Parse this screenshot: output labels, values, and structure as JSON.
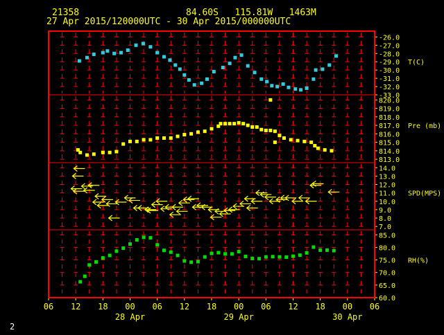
{
  "header": {
    "station": "21358",
    "location": "84.60S   115.81W   1463M",
    "period": "27 Apr 2015/120000UTC - 30 Apr 2015/000000UTC"
  },
  "footer": {
    "page_number": "2"
  },
  "colors": {
    "frame": "#ff0000",
    "grid_cross": "#ff0000",
    "header_text": "#ffff00",
    "axis_text": "#ffff00",
    "temperature": "#33ccdd",
    "pressure": "#ffff00",
    "wind": "#ffff00",
    "humidity": "#00dd00",
    "footer_text": "#ffffff"
  },
  "chart_data": {
    "type": "scatter",
    "x_axis": {
      "unit": "hours since 27 Apr 2015 06 UTC",
      "range": [
        0,
        72
      ],
      "tick_labels": [
        "06",
        "12",
        "18",
        "00",
        "06",
        "12",
        "18",
        "00",
        "06",
        "12",
        "18",
        "00",
        "06"
      ],
      "date_labels": [
        {
          "text": "28 Apr",
          "x": 18
        },
        {
          "text": "29 Apr",
          "x": 42
        },
        {
          "text": "30 Apr",
          "x": 66
        }
      ],
      "grid_lines_every_hours": 3
    },
    "panels": [
      {
        "name": "temperature",
        "label": "T(C)",
        "ylim": [
          -33.0,
          -25.3
        ],
        "tick_labels": [
          "-26.0",
          "-27.0",
          "-28.0",
          "-29.0",
          "-30.0",
          "-31.0",
          "-32.0",
          "-33.0"
        ],
        "tick_values": [
          -26,
          -27,
          -28,
          -29,
          -30,
          -31,
          -32,
          -33
        ],
        "label_at": -29.0,
        "points": [
          [
            6.8,
            -28.9
          ],
          [
            8.5,
            -28.5
          ],
          [
            10.0,
            -28.1
          ],
          [
            12.0,
            -27.9
          ],
          [
            13.0,
            -27.7
          ],
          [
            14.5,
            -28.0
          ],
          [
            16.0,
            -27.9
          ],
          [
            17.5,
            -27.6
          ],
          [
            19.3,
            -27.0
          ],
          [
            20.9,
            -26.8
          ],
          [
            22.5,
            -27.2
          ],
          [
            24.0,
            -27.9
          ],
          [
            25.5,
            -28.4
          ],
          [
            26.8,
            -28.8
          ],
          [
            28.0,
            -29.4
          ],
          [
            29.0,
            -29.9
          ],
          [
            30.0,
            -30.6
          ],
          [
            31.0,
            -31.2
          ],
          [
            32.2,
            -31.8
          ],
          [
            33.8,
            -31.6
          ],
          [
            35.0,
            -31.1
          ],
          [
            36.5,
            -30.2
          ],
          [
            38.5,
            -29.7
          ],
          [
            40.0,
            -29.2
          ],
          [
            41.2,
            -28.5
          ],
          [
            42.6,
            -28.2
          ],
          [
            44.0,
            -29.5
          ],
          [
            45.5,
            -30.3
          ],
          [
            47.0,
            -31.1
          ],
          [
            48.2,
            -31.4
          ],
          [
            49.3,
            -31.9
          ],
          [
            50.5,
            -32.0
          ],
          [
            51.8,
            -31.7
          ],
          [
            53.0,
            -32.1
          ],
          [
            54.5,
            -32.3
          ],
          [
            55.7,
            -32.4
          ],
          [
            57.0,
            -32.2
          ],
          [
            58.5,
            -31.1
          ],
          [
            59.0,
            -30.0
          ],
          [
            60.5,
            -29.9
          ],
          [
            62.0,
            -29.4
          ],
          [
            63.5,
            -28.3
          ]
        ]
      },
      {
        "name": "pressure",
        "label": "Pre (mb)",
        "ylim": [
          812.6,
          820.6
        ],
        "tick_labels": [
          "820.0",
          "819.0",
          "818.0",
          "817.0",
          "816.0",
          "815.0",
          "814.0",
          "813.0"
        ],
        "tick_values": [
          820,
          819,
          818,
          817,
          816,
          815,
          814,
          813
        ],
        "label_at": 817.0,
        "points": [
          [
            6.5,
            814.1
          ],
          [
            7.0,
            813.8
          ],
          [
            8.5,
            813.5
          ],
          [
            10.0,
            813.6
          ],
          [
            12.0,
            813.8
          ],
          [
            13.5,
            813.8
          ],
          [
            15.0,
            813.9
          ],
          [
            16.5,
            814.8
          ],
          [
            18.0,
            815.1
          ],
          [
            19.5,
            815.1
          ],
          [
            21.0,
            815.3
          ],
          [
            22.5,
            815.3
          ],
          [
            24.0,
            815.5
          ],
          [
            25.5,
            815.5
          ],
          [
            27.0,
            815.5
          ],
          [
            28.5,
            815.7
          ],
          [
            30.0,
            815.9
          ],
          [
            31.5,
            816.0
          ],
          [
            33.0,
            816.2
          ],
          [
            34.5,
            816.3
          ],
          [
            36.0,
            816.6
          ],
          [
            37.5,
            816.9
          ],
          [
            38.0,
            817.2
          ],
          [
            39.0,
            817.2
          ],
          [
            40.0,
            817.2
          ],
          [
            41.0,
            817.2
          ],
          [
            42.0,
            817.3
          ],
          [
            43.0,
            817.2
          ],
          [
            44.0,
            817.0
          ],
          [
            45.0,
            816.8
          ],
          [
            46.0,
            816.8
          ],
          [
            47.0,
            816.5
          ],
          [
            48.0,
            816.4
          ],
          [
            49.0,
            816.4
          ],
          [
            50.0,
            816.3
          ],
          [
            50.0,
            815.0
          ],
          [
            49.0,
            820.0
          ],
          [
            51.0,
            815.8
          ],
          [
            52.0,
            815.5
          ],
          [
            53.5,
            815.3
          ],
          [
            55.0,
            815.2
          ],
          [
            56.5,
            815.1
          ],
          [
            58.0,
            815.0
          ],
          [
            58.8,
            814.6
          ],
          [
            59.5,
            814.3
          ],
          [
            61.0,
            814.1
          ],
          [
            62.5,
            814.0
          ]
        ]
      },
      {
        "name": "wind",
        "label": "SPD(MPS)",
        "ylim": [
          6.6,
          14.6
        ],
        "tick_labels": [
          "14.0",
          "13.0",
          "12.0",
          "11.0",
          "10.0",
          "9.0",
          "8.0",
          "7.0"
        ],
        "tick_values": [
          14,
          13,
          12,
          11,
          10,
          9,
          8,
          7
        ],
        "label_at": 11.0,
        "arrows": [
          [
            6.8,
            13.9
          ],
          [
            6.5,
            13.0
          ],
          [
            6.2,
            11.5
          ],
          [
            6.7,
            11.2
          ],
          [
            8.5,
            11.8
          ],
          [
            10.0,
            11.9
          ],
          [
            9.0,
            11.3
          ],
          [
            11.5,
            10.6
          ],
          [
            11.0,
            9.9
          ],
          [
            12.0,
            9.5
          ],
          [
            13.0,
            10.2
          ],
          [
            14.0,
            9.7
          ],
          [
            14.5,
            8.0
          ],
          [
            16.0,
            9.9
          ],
          [
            18.0,
            10.4
          ],
          [
            19.0,
            10.1
          ],
          [
            20.0,
            9.2
          ],
          [
            21.0,
            9.2
          ],
          [
            22.5,
            9.0
          ],
          [
            23.0,
            8.9
          ],
          [
            24.0,
            9.6
          ],
          [
            25.0,
            10.0
          ],
          [
            26.0,
            9.1
          ],
          [
            27.0,
            9.3
          ],
          [
            28.0,
            8.4
          ],
          [
            28.5,
            9.3
          ],
          [
            29.5,
            8.8
          ],
          [
            30.0,
            9.8
          ],
          [
            31.0,
            10.2
          ],
          [
            32.0,
            10.3
          ],
          [
            33.0,
            9.3
          ],
          [
            34.0,
            9.5
          ],
          [
            35.0,
            9.3
          ],
          [
            36.5,
            9.0
          ],
          [
            37.0,
            8.1
          ],
          [
            38.0,
            8.8
          ],
          [
            39.0,
            8.5
          ],
          [
            40.0,
            8.9
          ],
          [
            41.0,
            9.0
          ],
          [
            42.0,
            9.4
          ],
          [
            43.5,
            9.7
          ],
          [
            44.5,
            10.3
          ],
          [
            45.0,
            9.2
          ],
          [
            46.0,
            10.0
          ],
          [
            47.0,
            11.0
          ],
          [
            48.0,
            10.8
          ],
          [
            49.0,
            10.5
          ],
          [
            50.0,
            10.0
          ],
          [
            51.5,
            10.2
          ],
          [
            52.5,
            10.4
          ],
          [
            53.5,
            10.4
          ],
          [
            55.0,
            10.0
          ],
          [
            56.5,
            10.4
          ],
          [
            58.0,
            10.0
          ],
          [
            59.0,
            11.9
          ],
          [
            59.5,
            12.1
          ],
          [
            63.0,
            11.1
          ]
        ]
      },
      {
        "name": "humidity",
        "label": "RH(%)",
        "ylim": [
          60.0,
          87.0
        ],
        "tick_labels": [
          "85.0",
          "80.0",
          "75.0",
          "70.0",
          "65.0",
          "60.0"
        ],
        "tick_values": [
          85,
          80,
          75,
          70,
          65,
          60
        ],
        "label_at": 75.0,
        "points": [
          [
            7.0,
            66.3
          ],
          [
            8.0,
            68.5
          ],
          [
            9.0,
            73.0
          ],
          [
            10.5,
            74.2
          ],
          [
            12.0,
            75.8
          ],
          [
            13.5,
            76.8
          ],
          [
            15.0,
            78.5
          ],
          [
            16.5,
            79.7
          ],
          [
            18.0,
            81.3
          ],
          [
            19.5,
            83.0
          ],
          [
            21.0,
            84.0
          ],
          [
            22.5,
            83.8
          ],
          [
            24.0,
            81.0
          ],
          [
            25.5,
            78.8
          ],
          [
            27.0,
            78.1
          ],
          [
            28.5,
            76.8
          ],
          [
            30.0,
            74.6
          ],
          [
            31.5,
            74.1
          ],
          [
            33.0,
            74.3
          ],
          [
            34.5,
            76.2
          ],
          [
            36.0,
            77.6
          ],
          [
            37.5,
            77.9
          ],
          [
            39.0,
            77.4
          ],
          [
            40.5,
            77.4
          ],
          [
            42.0,
            78.3
          ],
          [
            43.5,
            76.4
          ],
          [
            45.0,
            75.6
          ],
          [
            46.5,
            75.5
          ],
          [
            48.0,
            76.2
          ],
          [
            49.5,
            76.3
          ],
          [
            51.0,
            76.2
          ],
          [
            52.5,
            76.1
          ],
          [
            54.0,
            76.5
          ],
          [
            55.5,
            76.9
          ],
          [
            57.0,
            77.8
          ],
          [
            58.5,
            80.1
          ],
          [
            60.0,
            78.9
          ],
          [
            61.5,
            78.9
          ],
          [
            63.0,
            78.7
          ]
        ]
      }
    ]
  }
}
